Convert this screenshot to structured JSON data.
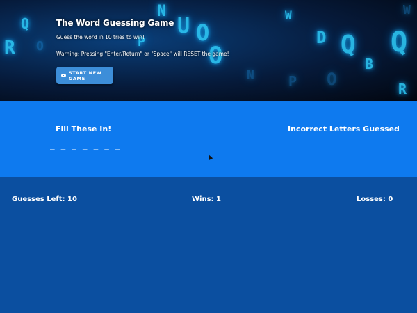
{
  "hero": {
    "title": "The Word Guessing Game",
    "subtitle": "Guess the word in 10 tries to win!",
    "warning": "Warning: Pressing \"Enter/Return\" or \"Space\" will RESET the game!",
    "start_button_label": "START NEW GAME",
    "start_button_icon": "gamepad-icon"
  },
  "board": {
    "fill_title": "Fill These In!",
    "blanks": "_ _ _ _ _ _ _",
    "incorrect_title": "Incorrect Letters Guessed",
    "incorrect_letters": ""
  },
  "stats": {
    "guesses_left": "Guesses Left: 10",
    "wins": "Wins: 1",
    "losses": "Losses: 0"
  },
  "colors": {
    "hero_bg": "#061a3a",
    "board_bg": "#0e7aef",
    "stats_bg": "#0b4fa0",
    "button_bg": "#3d8ed9",
    "glyph_glow": "#2fd0ff"
  }
}
